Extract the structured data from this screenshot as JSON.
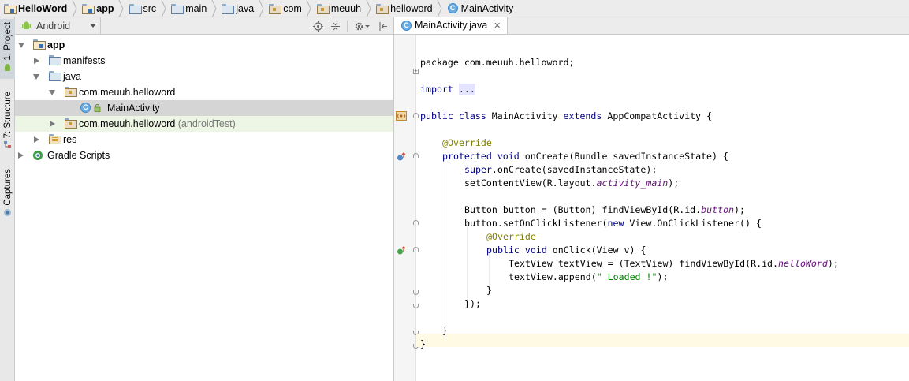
{
  "breadcrumbs": [
    {
      "label": "HelloWord",
      "icon": "module-folder-icon",
      "bold": true
    },
    {
      "label": "app",
      "icon": "module-folder-icon",
      "bold": true
    },
    {
      "label": "src",
      "icon": "folder-icon",
      "bold": false
    },
    {
      "label": "main",
      "icon": "folder-icon",
      "bold": false
    },
    {
      "label": "java",
      "icon": "folder-icon",
      "bold": false
    },
    {
      "label": "com",
      "icon": "package-icon",
      "bold": false
    },
    {
      "label": "meuuh",
      "icon": "package-icon",
      "bold": false
    },
    {
      "label": "helloword",
      "icon": "package-icon",
      "bold": false
    },
    {
      "label": "MainActivity",
      "icon": "class-icon",
      "bold": false
    }
  ],
  "tool_strip": {
    "project": "1: Project",
    "structure": "7: Structure",
    "captures": "Captures"
  },
  "project_panel": {
    "view_mode": "Android",
    "tree": [
      {
        "label": "app",
        "icon": "module-folder-icon",
        "expanded": true,
        "bold": true
      },
      {
        "label": "manifests",
        "icon": "folder-icon",
        "expanded": false
      },
      {
        "label": "java",
        "icon": "folder-icon",
        "expanded": true
      },
      {
        "label": "com.meuuh.helloword",
        "icon": "package-icon",
        "expanded": true
      },
      {
        "label": "MainActivity",
        "icon": "class-icon",
        "selected": true
      },
      {
        "label": "com.meuuh.helloword",
        "suffix": "(androidTest)",
        "icon": "package-icon",
        "expanded": false
      },
      {
        "label": "res",
        "icon": "res-folder-icon",
        "expanded": false
      },
      {
        "label": "Gradle Scripts",
        "icon": "gradle-icon",
        "expanded": false
      }
    ]
  },
  "editor": {
    "tab_label": "MainActivity.java",
    "code": {
      "l1": "package com.meuuh.helloword;",
      "l3_kw": "import",
      "l3_fold": "...",
      "l5_kw1": "public",
      "l5_kw2": "class",
      "l5_name": "MainActivity",
      "l5_kw3": "extends",
      "l5_base": "AppCompatActivity {",
      "l7": "@Override",
      "l8_kw1": "protected",
      "l8_kw2": "void",
      "l8_rest": "onCreate(Bundle savedInstanceState) {",
      "l9_kw": "super",
      "l9_rest": ".onCreate(savedInstanceState);",
      "l10_a": "setContentView(R.layout.",
      "l10_f": "activity_main",
      "l10_b": ");",
      "l12_a": "Button button = (Button) findViewById(R.id.",
      "l12_f": "button",
      "l12_b": ");",
      "l13_a": "button.setOnClickListener(",
      "l13_kw": "new",
      "l13_b": "View.OnClickListener() {",
      "l14": "@Override",
      "l15_kw1": "public",
      "l15_kw2": "void",
      "l15_rest": "onClick(View v) {",
      "l16_a": "TextView textView = (TextView) findViewById(R.id.",
      "l16_f": "helloWord",
      "l16_b": ");",
      "l17_a": "textView.append(",
      "l17_s": "\" Loaded !\"",
      "l17_b": ");",
      "l18": "}",
      "l19": "});",
      "l21": "}",
      "l22": "}"
    }
  }
}
